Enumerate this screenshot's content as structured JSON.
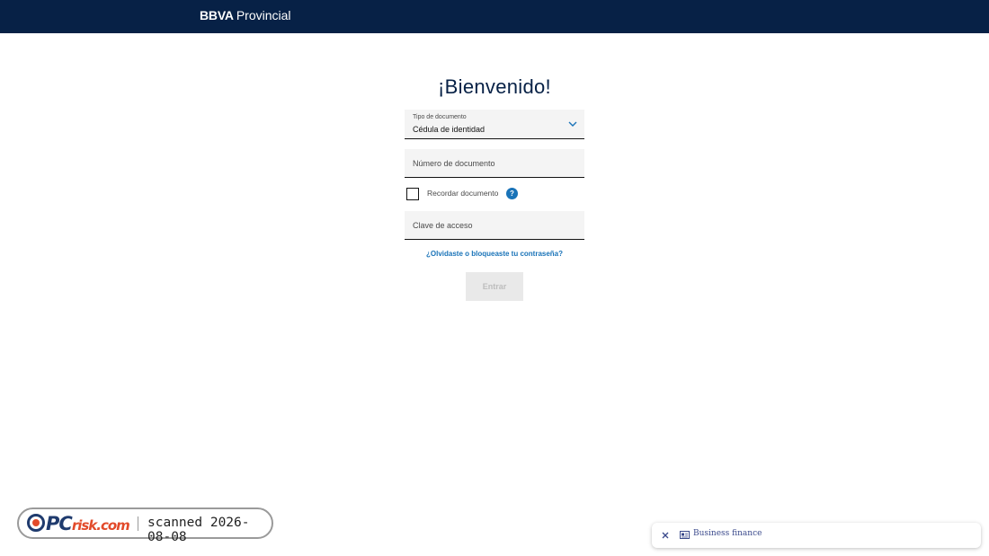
{
  "header": {
    "logo_primary": "BBVA",
    "logo_secondary": "Provincial",
    "background_color": "#072146"
  },
  "main": {
    "title": "¡Bienvenido!",
    "document_type": {
      "label": "Tipo de documento",
      "selected_value": "Cédula de identidad",
      "icon": "chevron-down-icon"
    },
    "document_number": {
      "placeholder": "Número de documento",
      "value": ""
    },
    "remember": {
      "label": "Recordar documento",
      "checked": false,
      "help_icon": "question-icon",
      "help_glyph": "?"
    },
    "password": {
      "placeholder": "Clave de acceso",
      "value": ""
    },
    "forgot_link": "¿Olvidaste o bloqueaste tu contraseña?",
    "submit_label": "Entrar",
    "accent_color": "#1973b8"
  },
  "watermark": {
    "brand_main": "PC",
    "brand_sub": "risk.com",
    "text": "scanned 2026-08-08"
  },
  "toast": {
    "close_icon": "close-icon",
    "icon": "newspaper-icon",
    "label": "Business finance"
  }
}
